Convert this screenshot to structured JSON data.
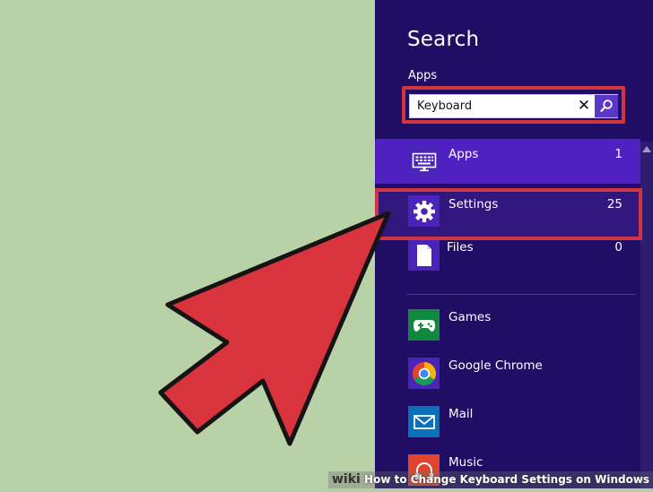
{
  "charm": {
    "title": "Search",
    "scope": "Apps",
    "search": {
      "value": "Keyboard",
      "placeholder": ""
    },
    "categories": [
      {
        "label": "Apps",
        "count": "1",
        "icon": "keyboard-icon"
      },
      {
        "label": "Settings",
        "count": "25",
        "icon": "gear-icon"
      },
      {
        "label": "Files",
        "count": "0",
        "icon": "document-icon"
      }
    ],
    "apps": [
      {
        "label": "Games",
        "icon": "gamepad-icon",
        "color": "#10893e"
      },
      {
        "label": "Google Chrome",
        "icon": "chrome-icon",
        "color": "#4a24b8"
      },
      {
        "label": "Mail",
        "icon": "mail-icon",
        "color": "#0a70b8"
      },
      {
        "label": "Music",
        "icon": "headphones-icon",
        "color": "#e0442c"
      }
    ]
  },
  "colors": {
    "desktop": "#b8d1a7",
    "charm_bg": "#1f0e63",
    "selected_row": "#4f21c0",
    "highlight": "#d1353e",
    "arrow": "#d9333e"
  },
  "watermark": {
    "brand": "wiki",
    "text": "How to Change Keyboard Settings on Windows 8"
  }
}
